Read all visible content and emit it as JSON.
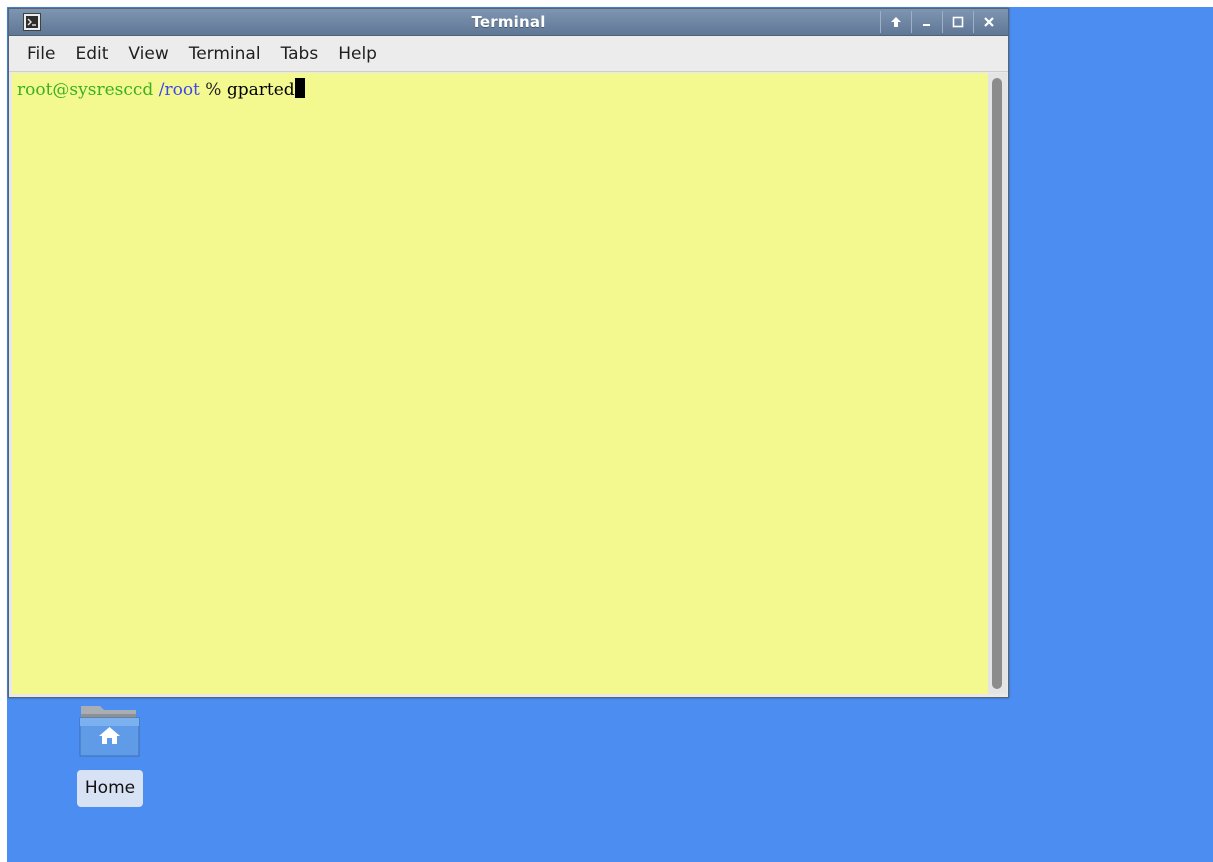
{
  "window": {
    "title": "Terminal",
    "buttons": [
      "up-arrow-icon",
      "minimize-icon",
      "maximize-icon",
      "close-icon"
    ]
  },
  "menubar": {
    "items": [
      "File",
      "Edit",
      "View",
      "Terminal",
      "Tabs",
      "Help"
    ]
  },
  "terminal": {
    "prompt_user_host": "root@sysresccd",
    "prompt_path": "/root",
    "prompt_symbol": "%",
    "command": "gparted",
    "colors": {
      "background": "#f4f98f",
      "user_host": "#3db01f",
      "path": "#3f46ee"
    }
  },
  "desktop": {
    "background_color": "#4b8df0",
    "icons": [
      {
        "label": "Home",
        "icon": "home-folder-icon"
      }
    ]
  }
}
